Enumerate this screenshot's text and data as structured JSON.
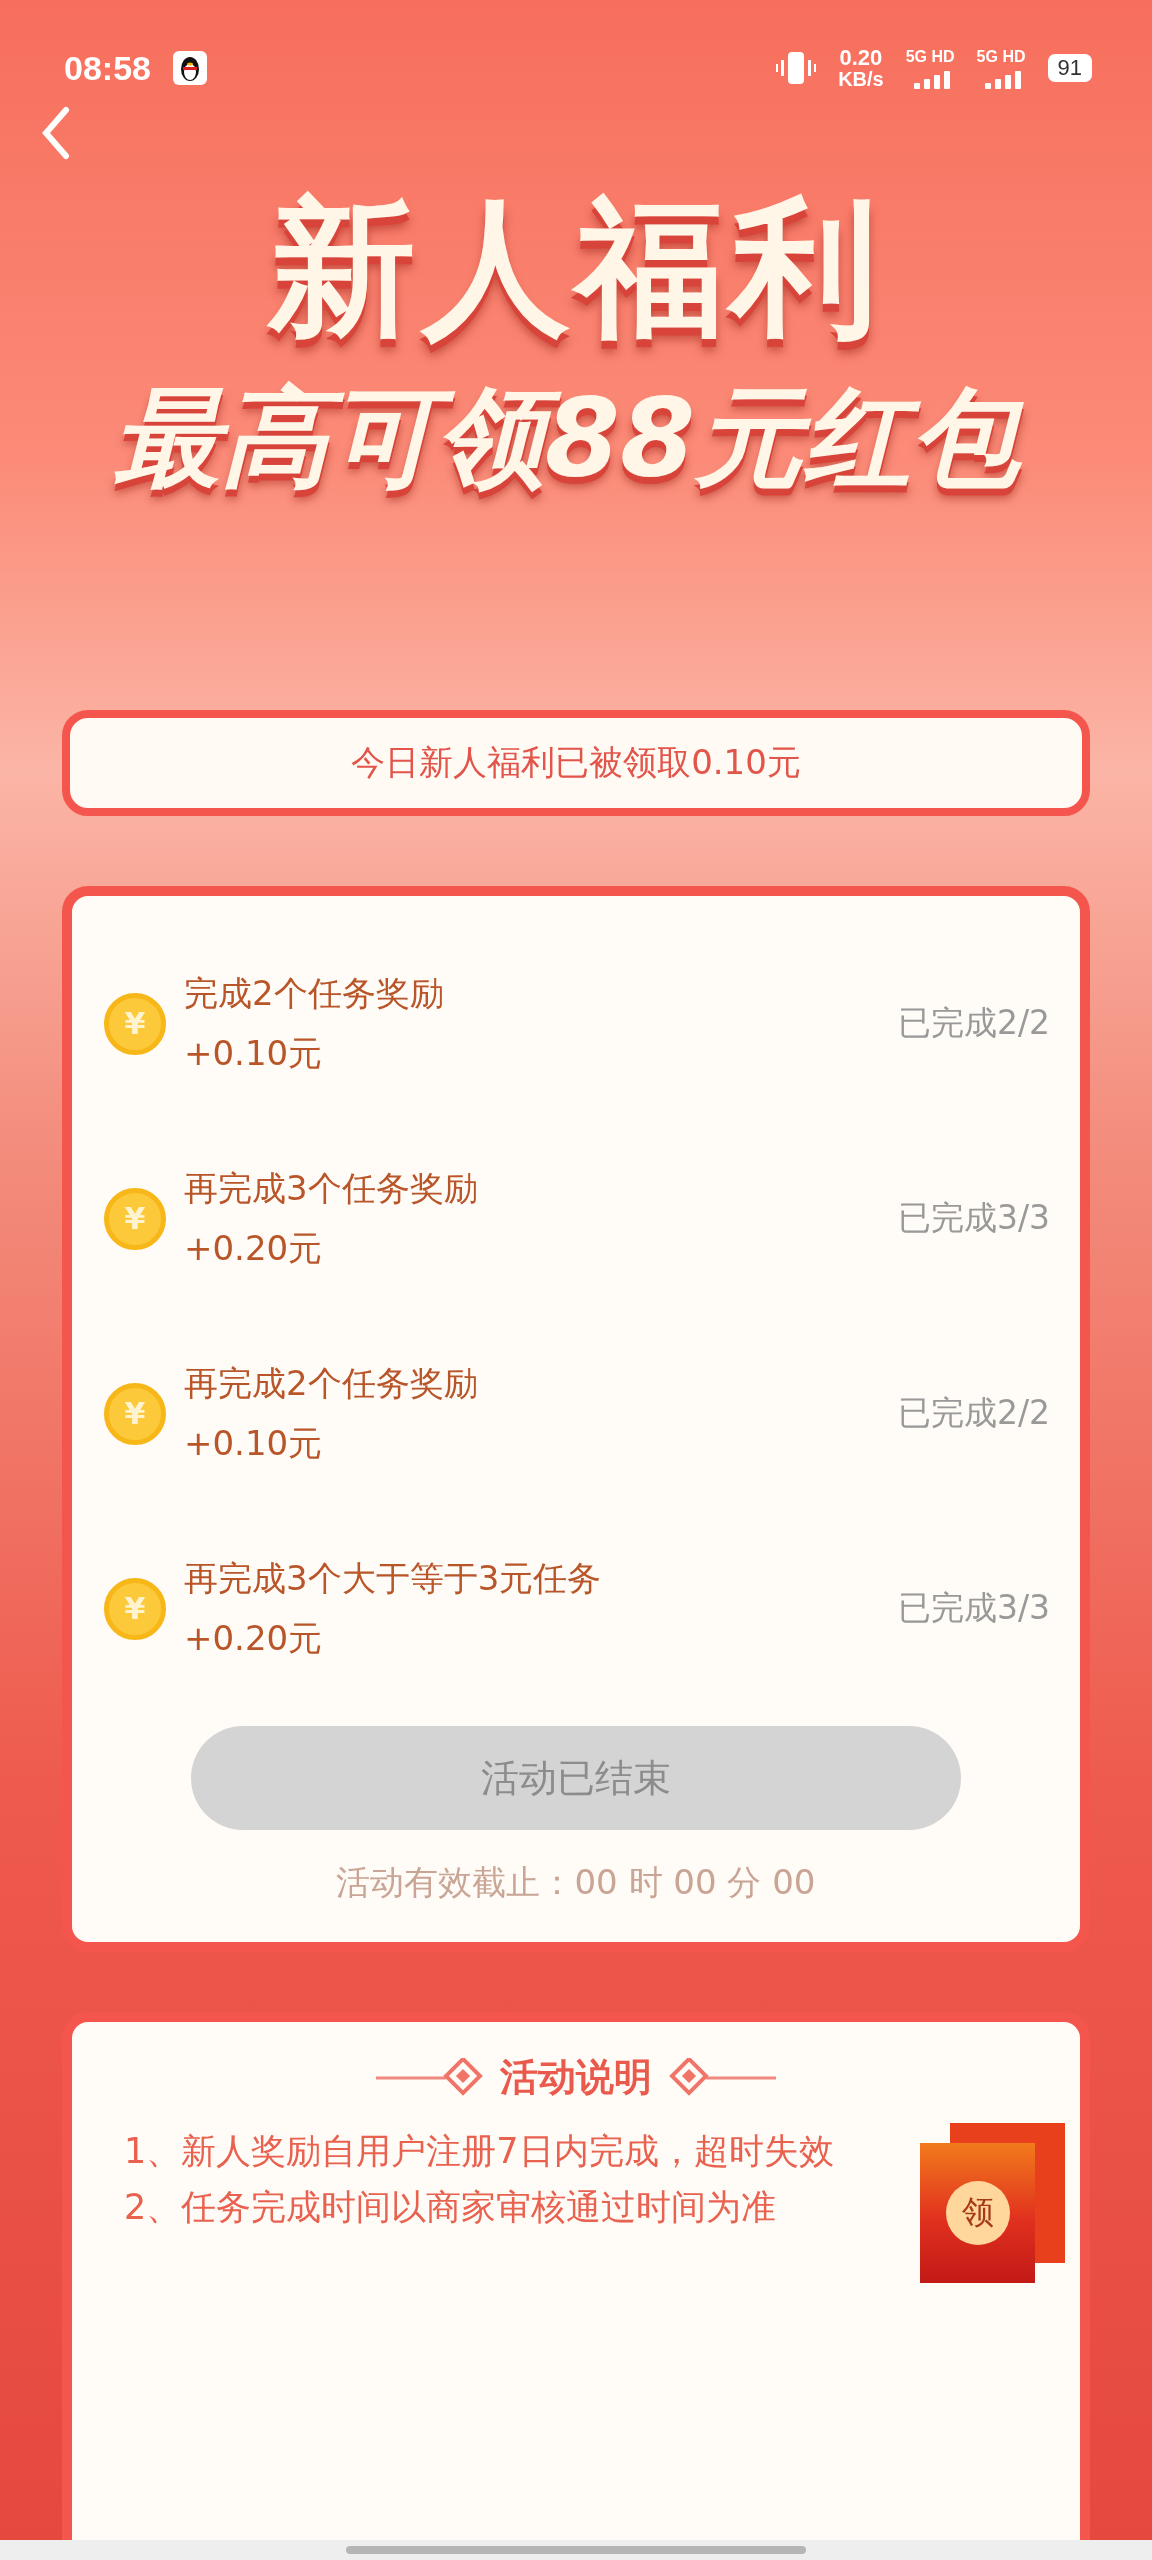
{
  "status_bar": {
    "time": "08:58",
    "net_speed": "0.20",
    "net_unit": "KB/s",
    "sim_1": "5G HD",
    "sim_2": "5G HD",
    "battery": "91"
  },
  "banner": {
    "title": "新人福利",
    "subtitle": "最高可领88元红包"
  },
  "notice": "今日新人福利已被领取0.10元",
  "tasks": [
    {
      "coin": "¥",
      "title": "完成2个任务奖励",
      "reward": "+0.10元",
      "progress": "已完成2/2",
      "completed": true
    },
    {
      "coin": "¥",
      "title": "再完成3个任务奖励",
      "reward": "+0.20元",
      "progress": "已完成3/3",
      "completed": true
    },
    {
      "coin": "¥",
      "title": "再完成2个任务奖励",
      "reward": "+0.10元",
      "progress": "已完成2/2",
      "completed": true
    },
    {
      "coin": "¥",
      "title": "再完成3个大于等于3元任务",
      "reward": "+0.20元",
      "progress": "已完成3/3",
      "completed": true
    }
  ],
  "action_button": {
    "label": "活动已结束",
    "disabled": true
  },
  "deadline": "活动有效截止：00 时 00 分 00",
  "rules": {
    "title": "活动说明",
    "items": [
      "1、新人奖励自用户注册7日内完成，超时失效",
      "2、任务完成时间以商家审核通过时间为准"
    ]
  },
  "floating_packet": {
    "label": "领"
  }
}
